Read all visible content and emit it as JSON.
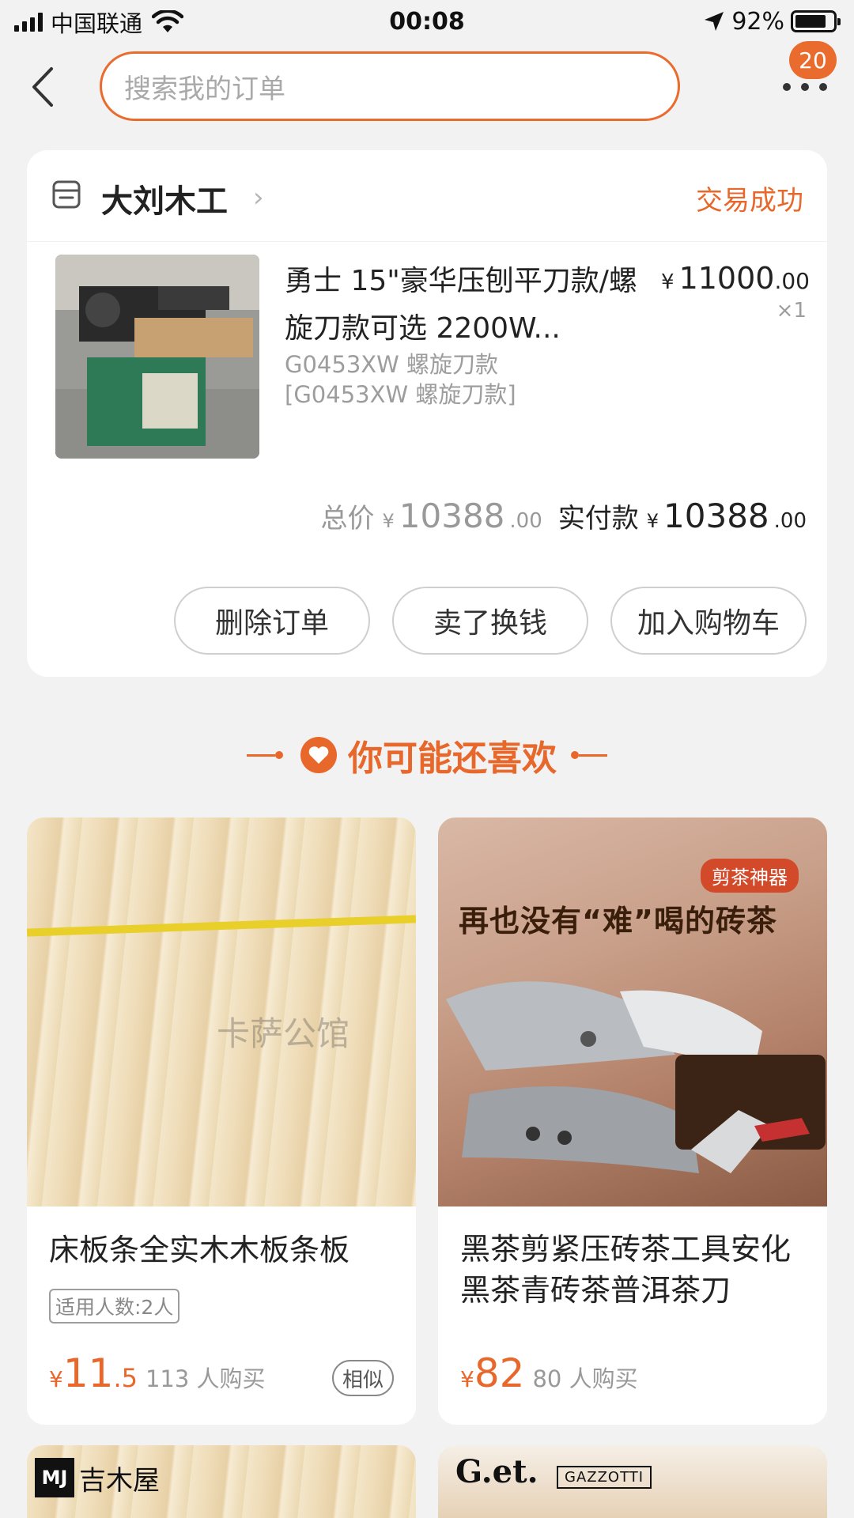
{
  "status_bar": {
    "carrier": "中国联通",
    "time": "00:08",
    "battery_pct": "92%"
  },
  "header": {
    "search_placeholder": "搜索我的订单",
    "badge_count": "20"
  },
  "order": {
    "shop_name": "大刘木工",
    "status": "交易成功",
    "product_title": "勇士 15\"豪华压刨平刀款/螺旋刀款可选 2200W...",
    "sku_line1": "G0453XW 螺旋刀款",
    "sku_line2": "[G0453XW 螺旋刀款]",
    "price_currency": "¥",
    "price_int": "11000",
    "price_dec": ".00",
    "qty": "×1",
    "total_label": "总价",
    "total_currency": "¥",
    "total_int": "10388",
    "total_dec": ".00",
    "paid_label": "实付款",
    "paid_currency": "¥",
    "paid_int": "10388",
    "paid_dec": ".00",
    "buttons": {
      "delete": "删除订单",
      "resell": "卖了换钱",
      "add_cart": "加入购物车"
    }
  },
  "recommend": {
    "title": "你可能还喜欢",
    "items": [
      {
        "watermark": "卡萨公馆",
        "title": "床板条全实木木板条板",
        "tag": "适用人数:2人",
        "currency": "¥",
        "price_int": "11",
        "price_dec": ".5",
        "sold": "113 人购买",
        "similar": "相似"
      },
      {
        "badge": "剪茶神器",
        "headline": "再也没有“难”喝的砖茶",
        "title": "黑茶剪紧压砖茶工具安化黑茶青砖茶普洱茶刀",
        "currency": "¥",
        "price_int": "82",
        "price_dec": "",
        "sold": "80 人购买"
      },
      {
        "logo_mark": "MJ",
        "logo_text": "吉木屋"
      },
      {
        "logo_get": "G.et.",
        "logo_gaz": "GAZZOTTI"
      }
    ]
  },
  "colors": {
    "accent": "#e8672b",
    "background": "#f2f2f2"
  }
}
